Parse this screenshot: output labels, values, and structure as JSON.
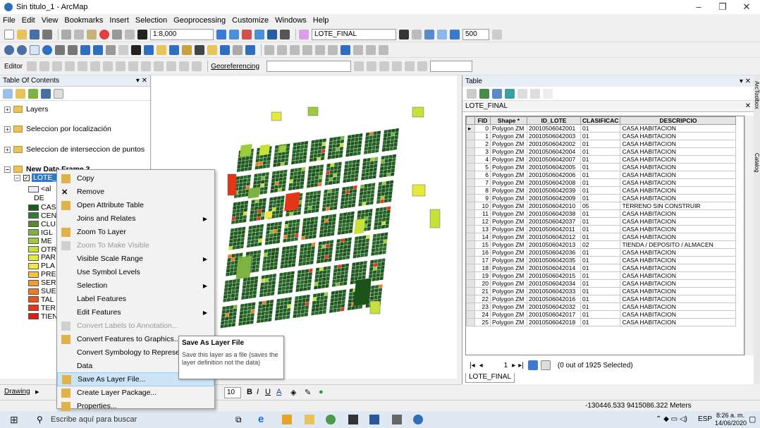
{
  "window": {
    "title": "Sin titulo_1 - ArcMap"
  },
  "menu": [
    "File",
    "Edit",
    "View",
    "Bookmarks",
    "Insert",
    "Selection",
    "Geoprocessing",
    "Customize",
    "Windows",
    "Help"
  ],
  "toolbar": {
    "scale": "1:8,000",
    "layer_combo": "LOTE_FINAL",
    "zoom_value": "500",
    "georef_label": "Georeferencing",
    "editor_label": "Editor"
  },
  "toc": {
    "title": "Table Of Contents",
    "items": [
      "Layers",
      "Seleccion por localización",
      "Seleccion de interseccion de puntos",
      "New Data Frame 3",
      "LOTE_",
      "<al",
      "DE"
    ],
    "legend": [
      {
        "label": "CAS",
        "color": "#1e5c1e"
      },
      {
        "label": "CEN",
        "color": "#2e7d32"
      },
      {
        "label": "CLU",
        "color": "#558b2f"
      },
      {
        "label": "IGL",
        "color": "#7cb342"
      },
      {
        "label": "ME",
        "color": "#9ccc3b"
      },
      {
        "label": "OTR",
        "color": "#c6e23a"
      },
      {
        "label": "PAR",
        "color": "#e5ea3a"
      },
      {
        "label": "PLA",
        "color": "#f0e54a"
      },
      {
        "label": "PRE",
        "color": "#f5c242"
      },
      {
        "label": "SER",
        "color": "#f29a35"
      },
      {
        "label": "SUE",
        "color": "#ee7a28"
      },
      {
        "label": "TAL",
        "color": "#e8521e"
      },
      {
        "label": "TER",
        "color": "#e53518"
      },
      {
        "label": "TIEN",
        "color": "#d91e10"
      }
    ]
  },
  "context_menu": {
    "items": [
      {
        "label": "Copy",
        "icon": "copy-icon",
        "disabled": false
      },
      {
        "label": "Remove",
        "icon": "remove-icon",
        "disabled": false
      },
      {
        "label": "Open Attribute Table",
        "icon": "table-icon",
        "disabled": false
      },
      {
        "label": "Joins and Relates",
        "icon": "",
        "disabled": false,
        "sub": true
      },
      {
        "label": "Zoom To Layer",
        "icon": "zoom-layer-icon",
        "disabled": false
      },
      {
        "label": "Zoom To Make Visible",
        "icon": "zoom-visible-icon",
        "disabled": true
      },
      {
        "label": "Visible Scale Range",
        "icon": "",
        "disabled": false,
        "sub": true
      },
      {
        "label": "Use Symbol Levels",
        "icon": "",
        "disabled": false
      },
      {
        "label": "Selection",
        "icon": "",
        "disabled": false,
        "sub": true
      },
      {
        "label": "Label Features",
        "icon": "",
        "disabled": false
      },
      {
        "label": "Edit Features",
        "icon": "",
        "disabled": false,
        "sub": true
      },
      {
        "label": "Convert Labels to Annotation...",
        "icon": "annotation-icon",
        "disabled": true
      },
      {
        "label": "Convert Features to Graphics...",
        "icon": "graphics-icon",
        "disabled": false
      },
      {
        "label": "Convert Symbology to Representation...",
        "icon": "",
        "disabled": false
      },
      {
        "label": "Data",
        "icon": "",
        "disabled": false,
        "sub": true
      },
      {
        "label": "Save As Layer File...",
        "icon": "layer-file-icon",
        "disabled": false,
        "highlight": true
      },
      {
        "label": "Create Layer Package...",
        "icon": "package-icon",
        "disabled": false
      },
      {
        "label": "Properties...",
        "icon": "properties-icon",
        "disabled": false
      }
    ]
  },
  "tooltip": {
    "title": "Save As Layer File",
    "text": "Save this layer as a file (saves the layer definition not the data)"
  },
  "table": {
    "pane_title": "Table",
    "name": "LOTE_FINAL",
    "columns": [
      "FID",
      "Shape *",
      "ID_LOTE",
      "CLASIFICAC",
      "DESCRIPCIO"
    ],
    "rows": [
      [
        "0",
        "Polygon ZM",
        "20010506042001",
        "01",
        "CASA HABITACION"
      ],
      [
        "1",
        "Polygon ZM",
        "20010506042003",
        "01",
        "CASA HABITACION"
      ],
      [
        "2",
        "Polygon ZM",
        "20010506042002",
        "01",
        "CASA HABITACION"
      ],
      [
        "3",
        "Polygon ZM",
        "20010506042004",
        "01",
        "CASA HABITACION"
      ],
      [
        "4",
        "Polygon ZM",
        "20010506042007",
        "01",
        "CASA HABITACION"
      ],
      [
        "5",
        "Polygon ZM",
        "20010506042005",
        "01",
        "CASA HABITACION"
      ],
      [
        "6",
        "Polygon ZM",
        "20010506042006",
        "01",
        "CASA HABITACION"
      ],
      [
        "7",
        "Polygon ZM",
        "20010506042008",
        "01",
        "CASA HABITACION"
      ],
      [
        "8",
        "Polygon ZM",
        "20010506042039",
        "01",
        "CASA HABITACION"
      ],
      [
        "9",
        "Polygon ZM",
        "20010506042009",
        "01",
        "CASA HABITACION"
      ],
      [
        "10",
        "Polygon ZM",
        "20010506042010",
        "05",
        "TERRENO SIN CONSTRUIR"
      ],
      [
        "11",
        "Polygon ZM",
        "20010506042038",
        "01",
        "CASA HABITACION"
      ],
      [
        "12",
        "Polygon ZM",
        "20010506042037",
        "01",
        "CASA HABITACION"
      ],
      [
        "13",
        "Polygon ZM",
        "20010506042011",
        "01",
        "CASA HABITACION"
      ],
      [
        "14",
        "Polygon ZM",
        "20010506042012",
        "01",
        "CASA HABITACION"
      ],
      [
        "15",
        "Polygon ZM",
        "20010506042013",
        "02",
        "TIENDA / DEPOSITO / ALMACEN"
      ],
      [
        "16",
        "Polygon ZM",
        "20010506042036",
        "01",
        "CASA HABITACION"
      ],
      [
        "17",
        "Polygon ZM",
        "20010506042035",
        "01",
        "CASA HABITACION"
      ],
      [
        "18",
        "Polygon ZM",
        "20010506042014",
        "01",
        "CASA HABITACION"
      ],
      [
        "19",
        "Polygon ZM",
        "20010506042015",
        "01",
        "CASA HABITACION"
      ],
      [
        "20",
        "Polygon ZM",
        "20010506042034",
        "01",
        "CASA HABITACION"
      ],
      [
        "21",
        "Polygon ZM",
        "20010506042033",
        "01",
        "CASA HABITACION"
      ],
      [
        "22",
        "Polygon ZM",
        "20010506042016",
        "01",
        "CASA HABITACION"
      ],
      [
        "23",
        "Polygon ZM",
        "20010506042032",
        "01",
        "CASA HABITACION"
      ],
      [
        "24",
        "Polygon ZM",
        "20010506042017",
        "01",
        "CASA HABITACION"
      ],
      [
        "25",
        "Polygon ZM",
        "20010506042018",
        "01",
        "CASA HABITACION"
      ]
    ],
    "nav_record": "1",
    "selected_text": "(0 out of 1925 Selected)",
    "tab": "LOTE_FINAL"
  },
  "drawing": {
    "label": "Drawing",
    "font_size": "10"
  },
  "status": {
    "coords": "-130446.533 9415086.322 Meters"
  },
  "taskbar": {
    "search": "Escribe aquí para buscar",
    "lang": "ESP",
    "time": "8:26 a. m.",
    "date": "14/06/2020"
  },
  "side_tabs": [
    "ArcToolbox",
    "Catalog"
  ]
}
